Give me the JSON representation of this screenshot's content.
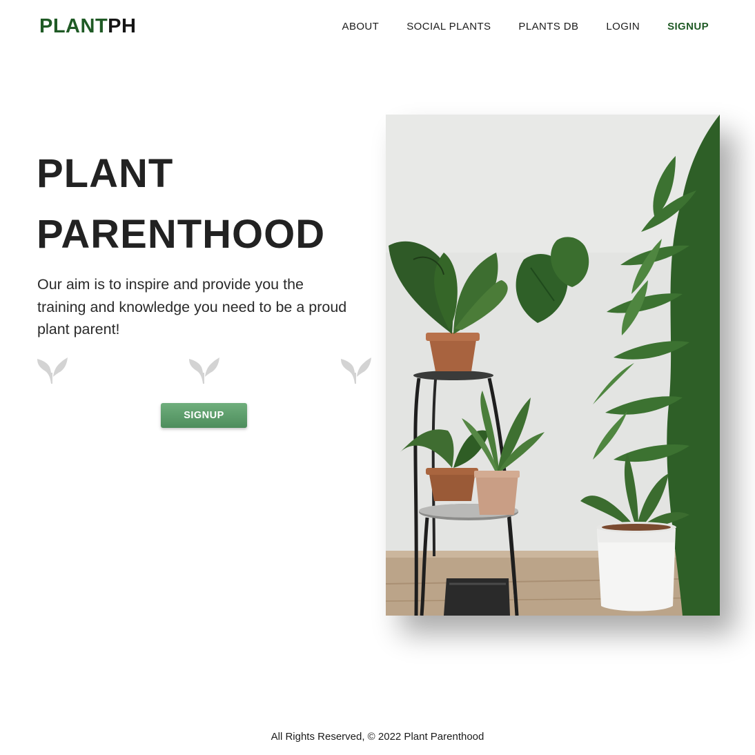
{
  "header": {
    "logo_part1": "PLANT",
    "logo_part2": "PH",
    "nav": [
      {
        "label": "ABOUT"
      },
      {
        "label": "SOCIAL PLANTS"
      },
      {
        "label": "PLANTS DB"
      },
      {
        "label": "LOGIN"
      },
      {
        "label": "SIGNUP",
        "active": true
      }
    ]
  },
  "hero": {
    "title_line1": "PLANT",
    "title_line2": "PARENTHOOD",
    "description": "Our aim is to inspire and provide you the training and knowledge you need to be a proud plant parent!",
    "cta_label": "SIGNUP",
    "decor_icon": "sprout-icon",
    "hero_image_icon": "houseplants-photo"
  },
  "footer": {
    "copyright": "All Rights Reserved, © 2022 Plant Parenthood"
  },
  "colors": {
    "brand_green": "#1f5a25",
    "button_green": "#5a9a67",
    "text_dark": "#222222",
    "decor_gray": "#d3d3d3"
  }
}
